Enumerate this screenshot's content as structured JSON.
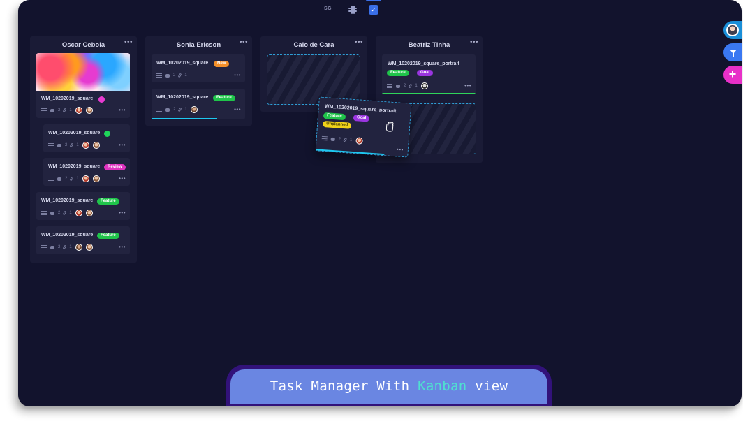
{
  "toolbar": {
    "workspace_initials": "SG"
  },
  "columns": [
    {
      "name": "Oscar Cebola",
      "menu": "•••",
      "cards": [
        {
          "title": "WM_10202019_square",
          "comments": "2",
          "attachments": "1",
          "status_dot": "#e83bd2",
          "has_image": true
        },
        {
          "title": "WM_10202019_square",
          "comments": "2",
          "attachments": "1",
          "status_dot": "#1fd65a"
        },
        {
          "title": "WM_10202019_square",
          "tag": "Review",
          "comments": "2",
          "attachments": "1"
        },
        {
          "title": "WM_10202019_square",
          "tag": "Feature",
          "comments": "2",
          "attachments": "1"
        },
        {
          "title": "WM_10202019_square",
          "tag": "Feature",
          "comments": "2",
          "attachments": "1"
        }
      ]
    },
    {
      "name": "Sonia Ericson",
      "menu": "•••",
      "cards": [
        {
          "title": "WM_10202019_square",
          "tag": "New",
          "comments": "2",
          "attachments": "1"
        },
        {
          "title": "WM_10202019_square",
          "tag": "Feature",
          "comments": "2",
          "attachments": "1",
          "progress": 0.7,
          "progress_color": "#1ec8f0"
        }
      ]
    },
    {
      "name": "Caio de Cara",
      "menu": "•••",
      "cards": []
    },
    {
      "name": "Beatriz Tinha",
      "menu": "•••",
      "cards": [
        {
          "title": "WM_10202019_square_portrait",
          "tags": [
            "Feature",
            "Goal"
          ],
          "comments": "2",
          "attachments": "1",
          "progress": 1.0,
          "progress_color": "#2fd45a"
        }
      ]
    }
  ],
  "dragged_card": {
    "title": "WM_10202019_square_portrait",
    "tags": [
      "Feature",
      "Goal",
      "Unplanned"
    ],
    "comments": "2",
    "attachments": "1",
    "progress": 0.75,
    "progress_color": "#1ec8f0"
  },
  "card_menu": "•••",
  "fab": {
    "add": "+"
  },
  "caption": {
    "before": "Task Manager With ",
    "highlight": "Kanban",
    "after": " view"
  },
  "colors": {
    "background": "#12132d",
    "column": "#1a1b36",
    "card": "#22233f",
    "accent": "#3a78f2"
  }
}
